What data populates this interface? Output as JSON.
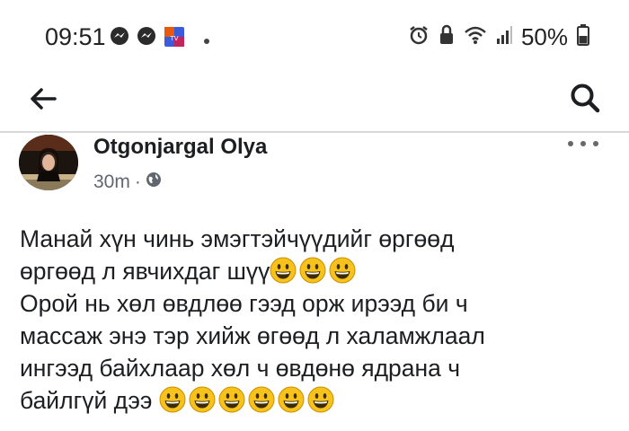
{
  "status_bar": {
    "time": "09:51",
    "battery": "50%",
    "notification_icons": [
      "messenger-icon",
      "messenger-icon",
      "app-icon",
      "dot-icon"
    ],
    "system_icons": [
      "alarm-icon",
      "lock-icon",
      "wifi-icon",
      "signal-icon",
      "battery-icon"
    ]
  },
  "nav": {
    "back_icon": "arrow-left-icon",
    "search_icon": "search-icon"
  },
  "post": {
    "author": "Otgonjargal Olya",
    "time_ago": "30m",
    "separator": "·",
    "privacy_icon": "globe-icon",
    "lines": [
      {
        "text": "Манай хүн чинь эмэгтэйчүүдийг өргөөд",
        "emoji_count": 0
      },
      {
        "text": "өргөөд л явчихдаг шүү",
        "emoji_count": 3
      },
      {
        "text": "Орой нь хөл өвдлөө гээд орж ирээд би ч",
        "emoji_count": 0
      },
      {
        "text": "массаж  энэ тэр хийж өгөөд л халамжлаал",
        "emoji_count": 0
      },
      {
        "text": "ингээд байхлаар хөл ч өвдөнө ядрана  ч",
        "emoji_count": 0
      },
      {
        "text": "байлгүй дээ ",
        "emoji_count": 6
      }
    ],
    "emoji_name": "grinning-face-emoji"
  },
  "colors": {
    "text": "#1c1e21",
    "meta": "#606770",
    "emoji_face": "#f7c21b",
    "divider": "#d7d8dc"
  }
}
